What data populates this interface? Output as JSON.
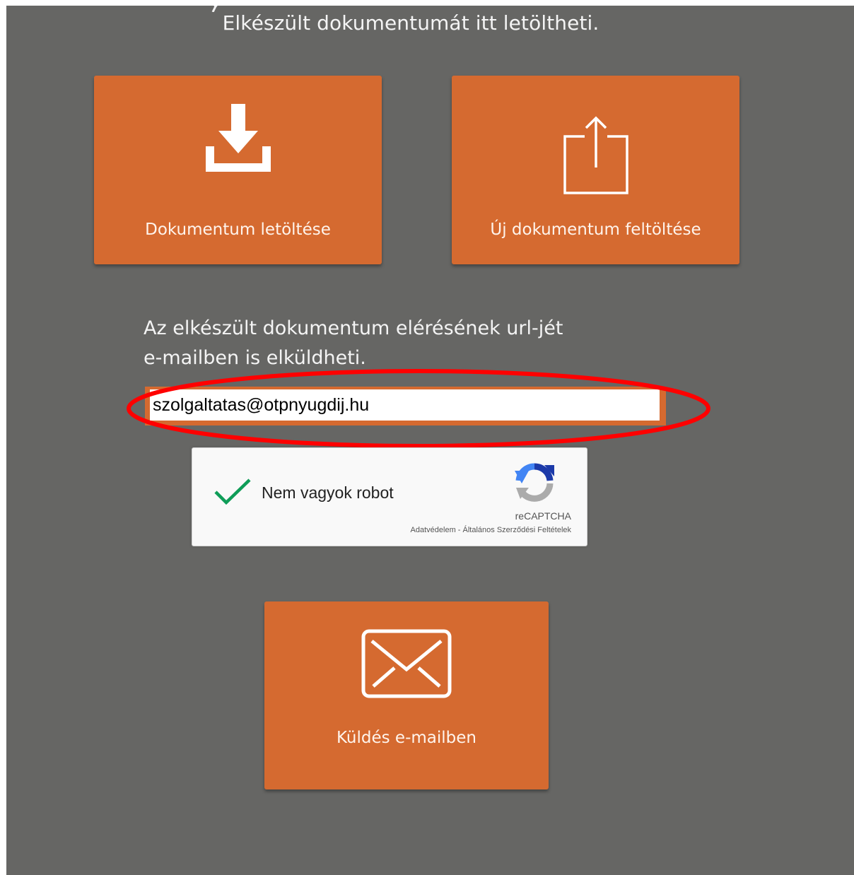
{
  "page": {
    "headline": "Elkészült dokumentumát itt letöltheti."
  },
  "actions": {
    "download_label": "Dokumentum letöltése",
    "upload_label": "Új dokumentum feltöltése",
    "send_email_label": "Küldés e-mailben"
  },
  "email_section": {
    "info_line1": "Az elkészült dokumentum elérésének url-jét",
    "info_line2": "e-mailben is elküldheti.",
    "email_value": "szolgaltatas@otpnyugdij.hu"
  },
  "captcha": {
    "label": "Nem vagyok robot",
    "brand": "reCAPTCHA",
    "privacy_link": "Adatvédelem",
    "separator": " - ",
    "terms_link": "Általános Szerződési Feltételek",
    "checked": true
  },
  "colors": {
    "background": "#666664",
    "tile": "#d56a30",
    "annotation": "#ff0000",
    "check": "#0f9d58"
  }
}
